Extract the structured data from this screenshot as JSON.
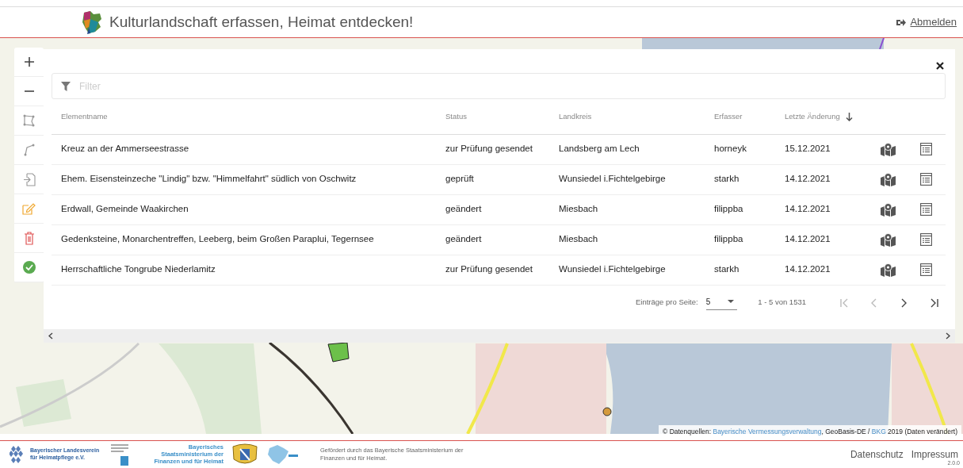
{
  "header": {
    "title": "Kulturlandschaft erfassen, Heimat entdecken!",
    "logout": "Abmelden"
  },
  "map_toolbar": [
    {
      "kind": "zoom_in"
    },
    {
      "kind": "zoom_out"
    },
    {
      "kind": "polygon"
    },
    {
      "kind": "line"
    },
    {
      "kind": "import"
    },
    {
      "kind": "edit"
    },
    {
      "kind": "delete"
    },
    {
      "kind": "confirm"
    }
  ],
  "panel": {
    "filter": {
      "placeholder": "Filter"
    },
    "columns": [
      {
        "label": "Elementname",
        "sorted": false
      },
      {
        "label": "Status",
        "sorted": false
      },
      {
        "label": "Landkreis",
        "sorted": false
      },
      {
        "label": "Erfasser",
        "sorted": false
      },
      {
        "label": "Letzte Änderung",
        "sorted": true
      }
    ],
    "rows": [
      {
        "cells": [
          "Kreuz an der Ammerseestrasse",
          "zur Prüfung gesendet",
          "Landsberg am Lech",
          "horneyk",
          "15.12.2021"
        ]
      },
      {
        "cells": [
          "Ehem. Eisensteinzeche \"Lindig\" bzw. \"Himmelfahrt\" südlich von Oschwitz",
          "geprüft",
          "Wunsiedel i.Fichtelgebirge",
          "starkh",
          "14.12.2021"
        ]
      },
      {
        "cells": [
          "Erdwall, Gemeinde Waakirchen",
          "geändert",
          "Miesbach",
          "filippba",
          "14.12.2021"
        ]
      },
      {
        "cells": [
          "Gedenksteine, Monarchentreffen, Leeberg, beim Großen Paraplui, Tegernsee",
          "geändert",
          "Miesbach",
          "filippba",
          "14.12.2021"
        ]
      },
      {
        "cells": [
          "Herrschaftliche Tongrube Niederlamitz",
          "zur Prüfung gesendet",
          "Wunsiedel i.Fichtelgebirge",
          "starkh",
          "14.12.2021"
        ]
      }
    ],
    "pagination": {
      "label": "Einträge pro Seite:",
      "page_size": "5",
      "range": "1 - 5 von 1531",
      "buttons": [
        {
          "kind": "first",
          "disabled": true
        },
        {
          "kind": "prev",
          "disabled": true
        },
        {
          "kind": "next",
          "disabled": false
        },
        {
          "kind": "last",
          "disabled": false
        }
      ]
    }
  },
  "attribution": [
    {
      "text": "© Datenquellen: ",
      "link": false
    },
    {
      "text": "Bayerische Vermessungsverwaltung",
      "link": true
    },
    {
      "text": ", GeoBasis-DE / ",
      "link": false
    },
    {
      "text": "BKG",
      "link": true
    },
    {
      "text": " 2019 (Daten verändert)",
      "link": false
    }
  ],
  "footer": {
    "association": "Bayerischer Landesverein für Heimatpflege e.V.",
    "ministry": "Bayerisches Staatsministerium der Finanzen und für Heimat",
    "funding": "Gefördert durch das Bayerische Staatsministerium der Finanzen und für Heimat.",
    "links": [
      "Datenschutz",
      "Impressum"
    ],
    "version": "2.0.0"
  }
}
